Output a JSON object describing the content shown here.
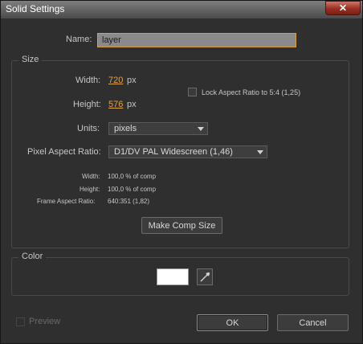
{
  "window": {
    "title": "Solid Settings",
    "close_glyph": "✕"
  },
  "name_field": {
    "label": "Name:",
    "value": "layer"
  },
  "size": {
    "legend": "Size",
    "width_label": "Width:",
    "width_value": "720",
    "width_unit": "px",
    "height_label": "Height:",
    "height_value": "576",
    "height_unit": "px",
    "lock_label": "Lock Aspect Ratio to 5:4 (1,25)",
    "units_label": "Units:",
    "units_value": "pixels",
    "par_label": "Pixel Aspect Ratio:",
    "par_value": "D1/DV PAL Widescreen (1,46)",
    "info": [
      {
        "label": "Width:",
        "value": "100,0 % of comp"
      },
      {
        "label": "Height:",
        "value": "100,0 % of comp"
      },
      {
        "label": "Frame Aspect Ratio:",
        "value": "640:351 (1,82)"
      }
    ],
    "make_comp_size": "Make Comp Size"
  },
  "color": {
    "legend": "Color",
    "swatch": "#ffffff"
  },
  "footer": {
    "preview_label": "Preview",
    "ok": "OK",
    "cancel": "Cancel"
  }
}
